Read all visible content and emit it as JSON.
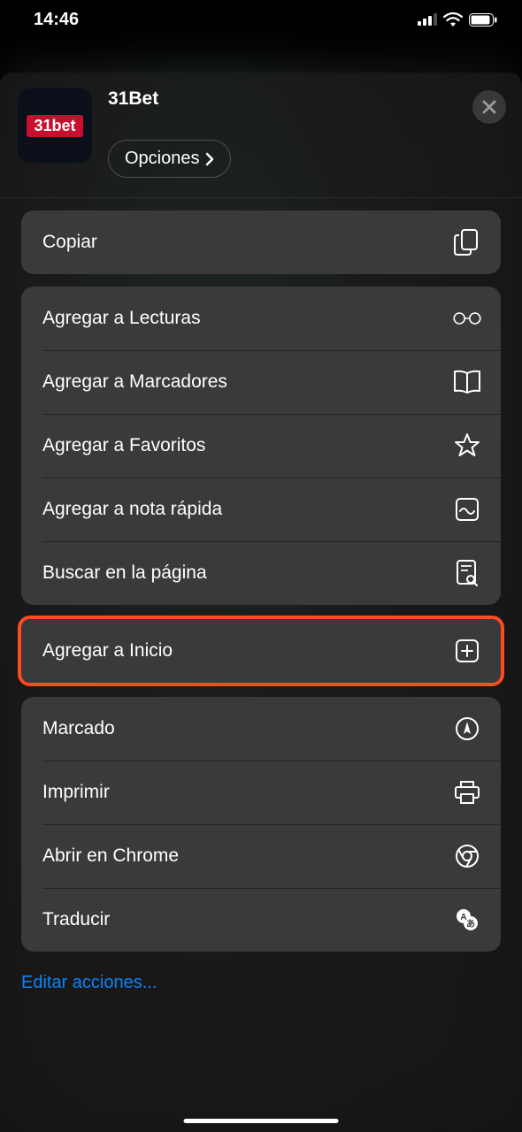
{
  "status": {
    "time": "14:46"
  },
  "header": {
    "app_name": "31Bet",
    "app_badge": "31bet",
    "options_label": "Opciones"
  },
  "groups": [
    {
      "rows": [
        {
          "label": "Copiar",
          "icon": "copy",
          "name": "action-copy"
        }
      ]
    },
    {
      "rows": [
        {
          "label": "Agregar a Lecturas",
          "icon": "glasses",
          "name": "action-reading-list"
        },
        {
          "label": "Agregar a Marcadores",
          "icon": "book",
          "name": "action-bookmark"
        },
        {
          "label": "Agregar a Favoritos",
          "icon": "star",
          "name": "action-favorites"
        },
        {
          "label": "Agregar a nota rápida",
          "icon": "quicknote",
          "name": "action-quick-note"
        },
        {
          "label": "Buscar en la página",
          "icon": "findpage",
          "name": "action-find-on-page"
        },
        {
          "label": "Agregar a Inicio",
          "icon": "addhome",
          "name": "action-add-to-home",
          "highlight": true
        }
      ]
    },
    {
      "rows": [
        {
          "label": "Marcado",
          "icon": "markup",
          "name": "action-markup"
        },
        {
          "label": "Imprimir",
          "icon": "print",
          "name": "action-print"
        },
        {
          "label": "Abrir en Chrome",
          "icon": "chrome",
          "name": "action-open-chrome"
        },
        {
          "label": "Traducir",
          "icon": "translate",
          "name": "action-translate"
        }
      ]
    }
  ],
  "footer": {
    "edit_label": "Editar acciones..."
  }
}
